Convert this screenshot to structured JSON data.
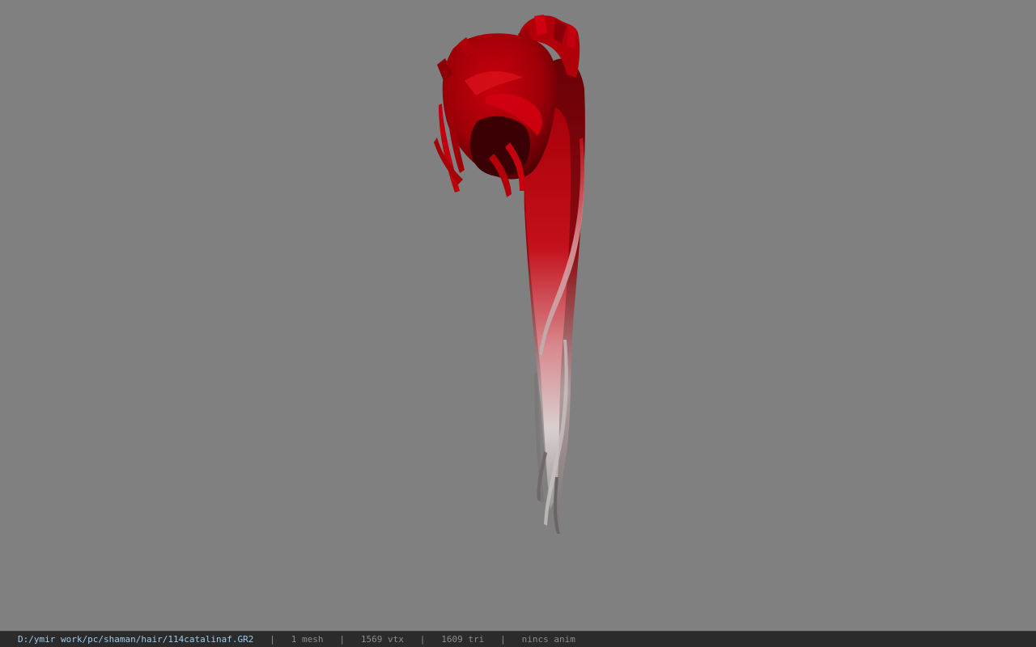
{
  "viewport": {
    "background": "#808080",
    "model": {
      "description": "hair-model",
      "primary_color": "#b00008",
      "shadow_color": "#4a0005",
      "tip_color": "#d8d0d0"
    }
  },
  "statusbar": {
    "file_path": "D:/ymir work/pc/shaman/hair/114catalinaf.GR2",
    "separator": "|",
    "mesh_count": "1 mesh",
    "vertex_count": "1569 vtx",
    "triangle_count": "1609 tri",
    "anim_status": "nincs anim",
    "path_color": "#9fc9e6",
    "text_color": "#8c8c8c",
    "background": "#2b2b2b"
  }
}
